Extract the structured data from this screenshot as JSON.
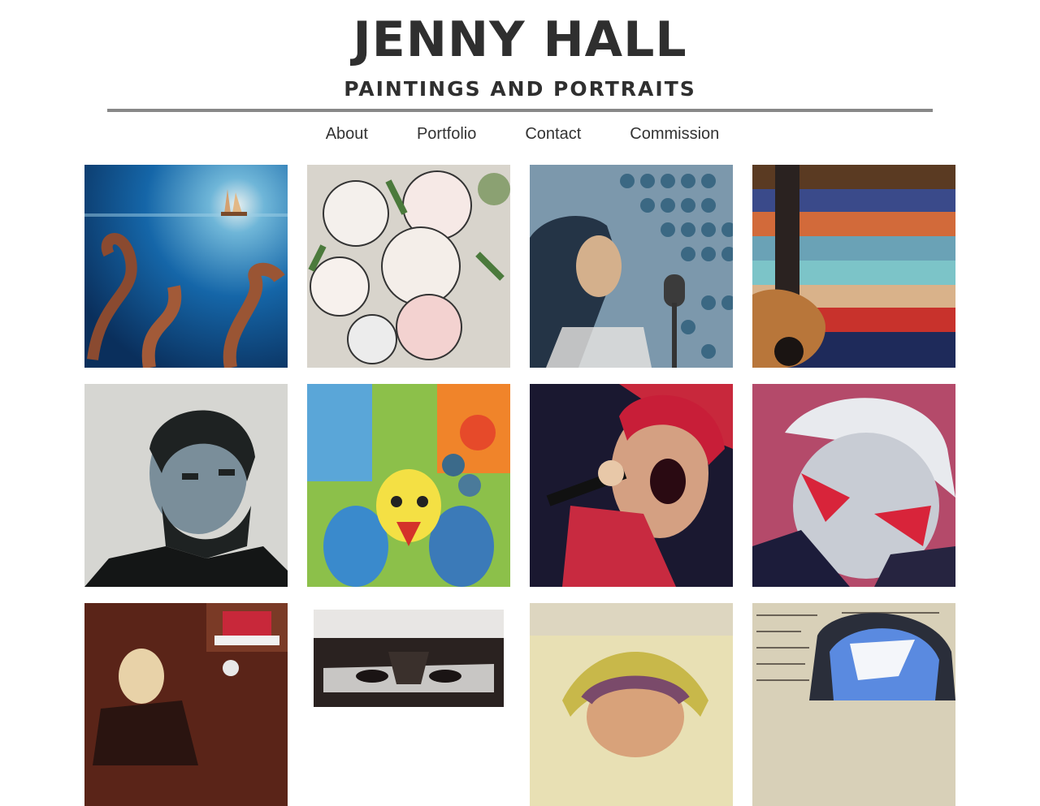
{
  "header": {
    "title": "JENNY HALL",
    "subtitle": "PAINTINGS AND PORTRAITS"
  },
  "nav": {
    "items": [
      {
        "label": "About"
      },
      {
        "label": "Portfolio"
      },
      {
        "label": "Contact"
      },
      {
        "label": "Commission"
      }
    ]
  },
  "gallery": {
    "tiles": [
      {
        "icon": "ocean-ship-tentacles-painting"
      },
      {
        "icon": "rose-bouquet-painting"
      },
      {
        "icon": "jazz-singer-microphone-painting"
      },
      {
        "icon": "guitar-stripes-painting"
      },
      {
        "icon": "bearded-man-portrait"
      },
      {
        "icon": "colorful-peacock-painting"
      },
      {
        "icon": "rock-singer-portrait"
      },
      {
        "icon": "gray-haired-man-portrait"
      },
      {
        "icon": "man-with-camera-painting"
      },
      {
        "icon": "smiling-man-portrait"
      },
      {
        "icon": "woman-portrait-yellow"
      },
      {
        "icon": "newspaper-collage-portrait"
      }
    ]
  },
  "colors": {
    "title": "#2f2f2f",
    "rule": "#888888",
    "nav_text": "#333333"
  }
}
